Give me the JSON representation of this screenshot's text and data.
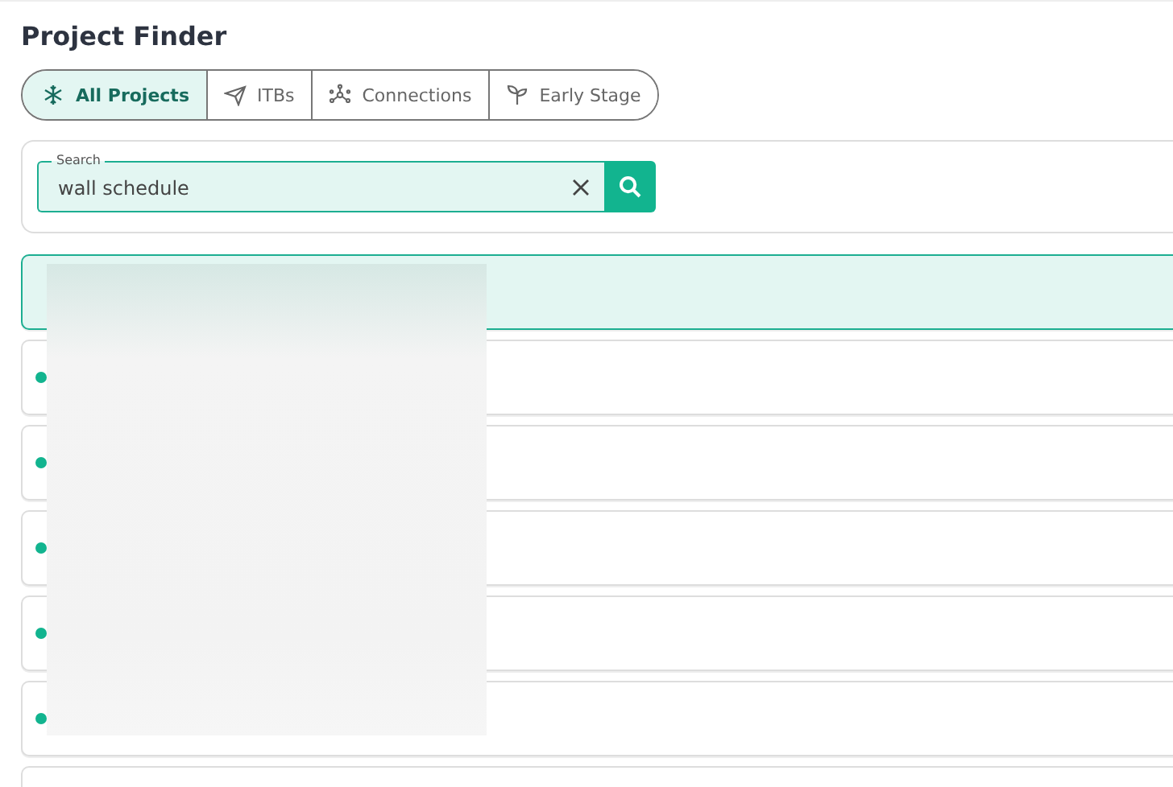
{
  "page_title": "Project Finder",
  "tabs": [
    {
      "label": "All Projects",
      "kind": "projects",
      "selected": true
    },
    {
      "label": "ITBs",
      "kind": "plane",
      "selected": false
    },
    {
      "label": "Connections",
      "kind": "network",
      "selected": false
    },
    {
      "label": "Early Stage",
      "kind": "sprout",
      "selected": false
    }
  ],
  "search": {
    "label": "Search",
    "value": "wall schedule"
  },
  "results": [
    {
      "selected": true
    },
    {
      "selected": false
    },
    {
      "selected": false
    },
    {
      "selected": false
    },
    {
      "selected": false
    },
    {
      "selected": false
    },
    {
      "selected": false
    }
  ]
}
